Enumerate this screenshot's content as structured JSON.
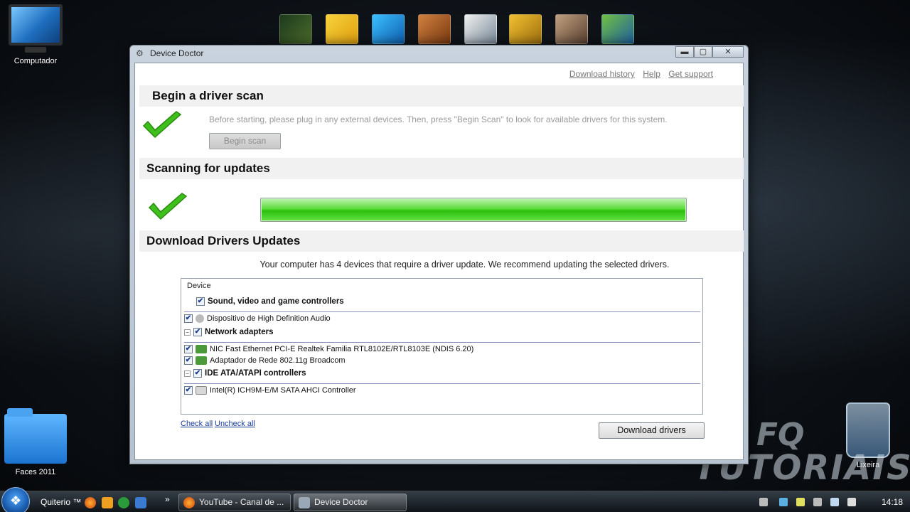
{
  "desktop": {
    "icons": [
      {
        "label": "Computador"
      },
      {
        "label": "Faces 2011"
      },
      {
        "label": "Lixeira"
      }
    ],
    "watermark": {
      "line1": "FQ",
      "line2": "TUTORIAIS"
    }
  },
  "window": {
    "title": "Device Doctor",
    "controls": {
      "minimize": "▬",
      "maximize": "▢",
      "close": "✕"
    },
    "links": {
      "history": "Download history",
      "help": "Help",
      "support": "Get support"
    },
    "scan_section": {
      "heading": "Begin a driver scan",
      "description": "Before starting, please plug in any external devices. Then, press \"Begin Scan\" to look for available drivers for this system.",
      "button": "Begin scan"
    },
    "updates_section": {
      "heading": "Scanning for updates",
      "progress": 1.0
    },
    "download_section": {
      "heading": "Download Drivers Updates",
      "summary": "Your computer has 4 devices that require a driver update. We recommend updating the selected drivers.",
      "list_header": "Device",
      "groups": [
        {
          "name": "Sound, video and game controllers",
          "devices": [
            "Dispositivo de High Definition Audio"
          ]
        },
        {
          "name": "Network adapters",
          "devices": [
            "NIC Fast Ethernet PCI-E Realtek Familia RTL8102E/RTL8103E (NDIS 6.20)",
            "Adaptador de Rede 802.11g Broadcom"
          ]
        },
        {
          "name": "IDE ATA/ATAPI controllers",
          "devices": [
            "Intel(R) ICH9M-E/M SATA AHCI Controller"
          ]
        }
      ],
      "check_all": "Check all",
      "uncheck_all": "Uncheck all",
      "download_button": "Download drivers"
    }
  },
  "taskbar": {
    "quicklaunch_label": "Quiterio ™",
    "overflow": "»",
    "buttons": [
      {
        "label": "YouTube - Canal de ..."
      },
      {
        "label": "Device Doctor"
      }
    ],
    "clock": "14:18"
  },
  "colors": {
    "progress": "#2cc00e",
    "check": "#3fbf1c",
    "link": "#1a3d9a"
  }
}
